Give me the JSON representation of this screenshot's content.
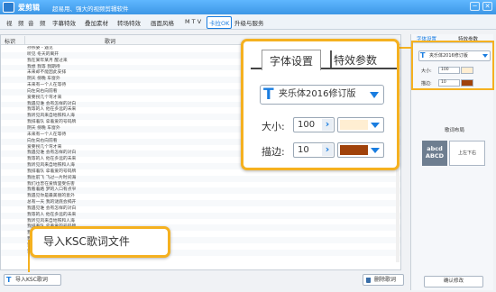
{
  "titlebar": {
    "app_name": "爱剪辑",
    "slogan": "超易用、强大的视频剪辑软件",
    "min_icon": "─",
    "close_icon": "✕"
  },
  "menu": {
    "items": [
      "视　频",
      "音　频",
      "字幕特效",
      "叠加素材",
      "转场特效",
      "画面风格",
      "M T V",
      "卡拉OK",
      "升级与服务"
    ],
    "active": "卡拉OK"
  },
  "lyrics_list": {
    "col_tag": "标识",
    "col_lyric": "歌词",
    "rows": [
      "孙燕姿 - 遇见",
      "听见 冬天的离开",
      "我在某年某月 醒过来",
      "我想 我等 我期待",
      "未来却不能因此安排",
      "阴天 傍晚 车窗外",
      "未来有一个人在等待",
      "向左向右向前看",
      "爱要拐几个弯才来",
      "我遇见谁 会有怎样的对白",
      "我等的人 他在多远的未来",
      "我听见风来自地铁和人海",
      "我排着队 拿着爱的号码牌",
      "阴天 傍晚 车窗外",
      "未来有一个人在等待",
      "向左向右向前看",
      "爱要拐几个弯才来",
      "我遇见谁 会有怎样的对白",
      "我等的人 他在多远的未来",
      "我听见风来自地铁和人海",
      "我排着队 拿着爱的号码牌",
      "我往前飞 飞过一片时间海",
      "我们也曾在爱情里受伤害",
      "我看着路 梦的入口有点窄",
      "我遇见你是最美丽的意外",
      "总有一天 我的谜底会揭开",
      "我遇见谁 会有怎样的对白",
      "我等的人 他在多远的未来",
      "我听见风来自地铁和人海",
      "我排着队 拿着爱的号码牌",
      "我往前飞 飞过一片时间海",
      "我们也曾在爱情里受伤害",
      "我看着路 梦的入口有点窄",
      "我遇见你是最美丽的意外"
    ]
  },
  "footer": {
    "import_label": "导入KSC歌词",
    "delete_label": "删除歌词"
  },
  "right_panel": {
    "tab_font": "字体设置",
    "tab_effect": "特效参数",
    "font_name": "夹乐体2016修订版",
    "size_label": "大小:",
    "size_value": "100",
    "stroke_label": "描边:",
    "stroke_value": "10",
    "layout_title": "歌词布局",
    "preview_text": "abcd ABCD",
    "layout_option": "上左下右",
    "confirm_label": "确认修改"
  },
  "callout": {
    "tab_font": "字体设置",
    "tab_effect": "特效参数",
    "font_name": "夹乐体2016修订版",
    "size_label": "大小:",
    "size_value": "100",
    "stroke_label": "描边:",
    "stroke_value": "10",
    "spin_icon": "›"
  },
  "import_callout": {
    "text": "导入KSC歌词文件"
  },
  "colors": {
    "accent": "#1a7de0",
    "highlight": "#f5b120",
    "fill_color": "#ffeed2",
    "stroke_color": "#a0420a"
  }
}
